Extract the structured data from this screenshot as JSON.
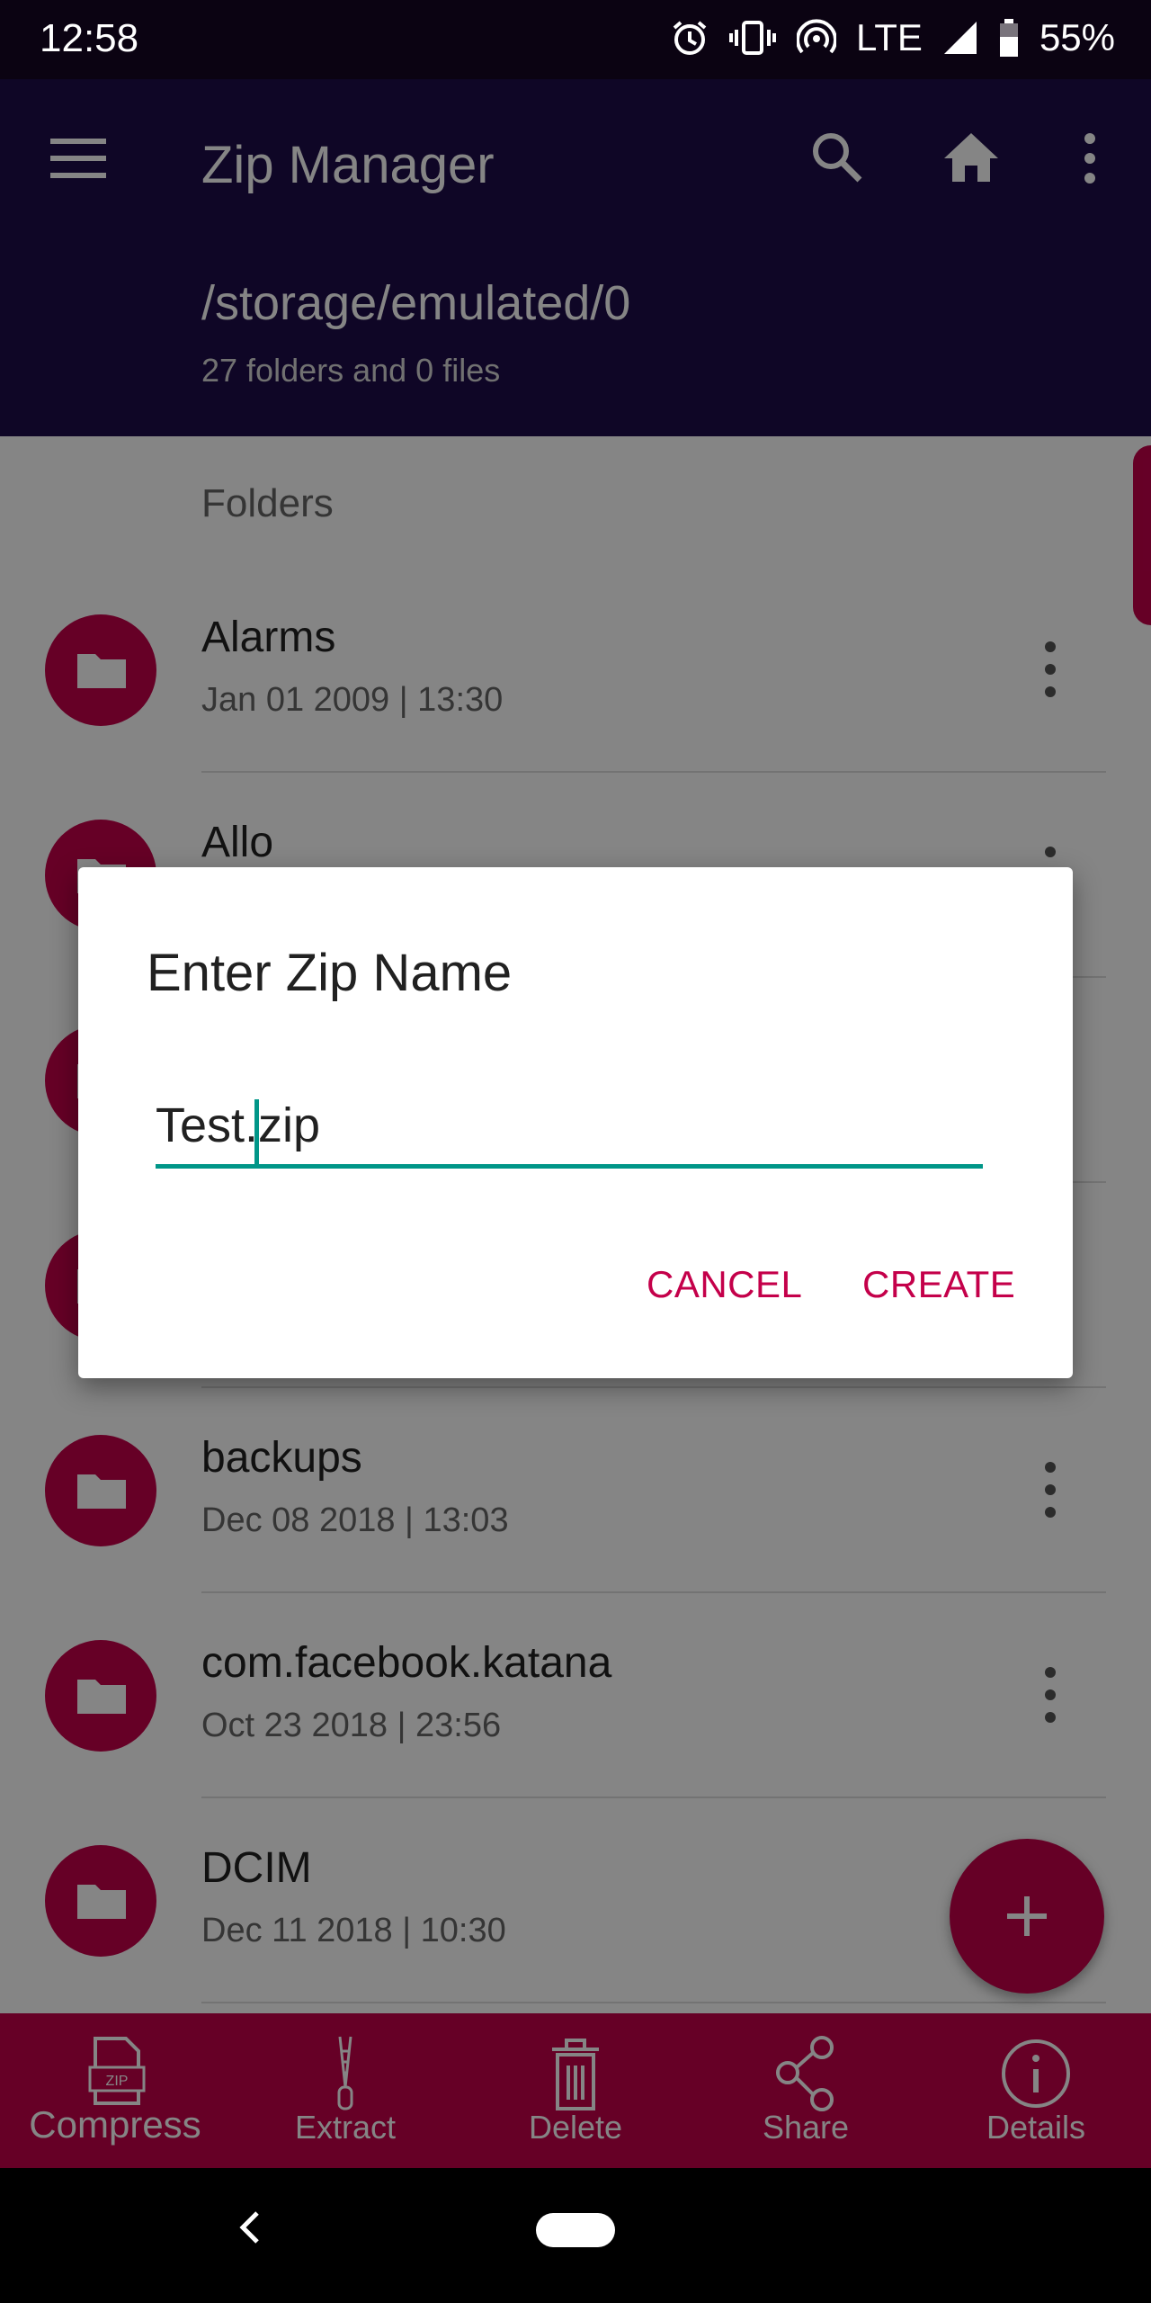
{
  "status_bar": {
    "time": "12:58",
    "network": "LTE",
    "battery": "55%"
  },
  "app_bar": {
    "title": "Zip Manager",
    "path": "/storage/emulated/0",
    "summary": "27 folders and 0 files"
  },
  "section_label": "Folders",
  "folders": [
    {
      "name": "Alarms",
      "date": "Jan 01 2009 | 13:30"
    },
    {
      "name": "Allo",
      "date": ""
    },
    {
      "name": "",
      "date": ""
    },
    {
      "name": "",
      "date": ""
    },
    {
      "name": "backups",
      "date": "Dec 08 2018 | 13:03"
    },
    {
      "name": "com.facebook.katana",
      "date": "Oct 23 2018 | 23:56"
    },
    {
      "name": "DCIM",
      "date": "Dec 11 2018 | 10:30"
    }
  ],
  "bottom_tabs": [
    {
      "label": "Compress",
      "icon": "zip-file-icon"
    },
    {
      "label": "Extract",
      "icon": "zipper-icon"
    },
    {
      "label": "Delete",
      "icon": "trash-icon"
    },
    {
      "label": "Share",
      "icon": "share-icon"
    },
    {
      "label": "Details",
      "icon": "info-icon"
    }
  ],
  "dialog": {
    "title": "Enter Zip Name",
    "input_value": "Test.zip",
    "cancel_label": "CANCEL",
    "create_label": "CREATE"
  },
  "colors": {
    "app_bar": "#1d0c49",
    "accent": "#c4004a",
    "input_underline": "#009688"
  }
}
